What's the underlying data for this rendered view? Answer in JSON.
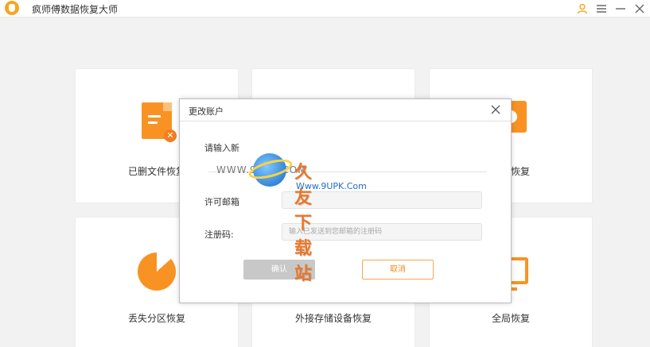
{
  "app": {
    "title": "疯师傅数据恢复大师"
  },
  "titlebar_icons": [
    "user-icon",
    "menu-icon",
    "minimize-icon",
    "close-icon"
  ],
  "cards": [
    {
      "label": "已删文件恢复",
      "icon": "deleted-file-icon"
    },
    {
      "label": "",
      "icon": ""
    },
    {
      "label": "磁盘恢复",
      "icon": "disk-icon"
    },
    {
      "label": "丢失分区恢复",
      "icon": "partition-pie-icon"
    },
    {
      "label": "外接存储设备恢复",
      "icon": ""
    },
    {
      "label": "全局恢复",
      "icon": "monitor-icon"
    }
  ],
  "dialog": {
    "title": "更改账户",
    "prompt_label": "请输入新",
    "email_label": "许可邮箱",
    "email_placeholder": "",
    "code_label": "注册码:",
    "code_placeholder": "输入已发送到您邮箱的注册码",
    "ok_label": "确认",
    "cancel_label": "取消"
  },
  "watermark": {
    "brand": "久友下载站",
    "url": "Www.9UPK.Com",
    "left_text": "WWW.9UPK.COM"
  },
  "colors": {
    "accent": "#f89323",
    "cancel_text": "#f08a24",
    "ok_disabled": "#c8c8c8"
  }
}
